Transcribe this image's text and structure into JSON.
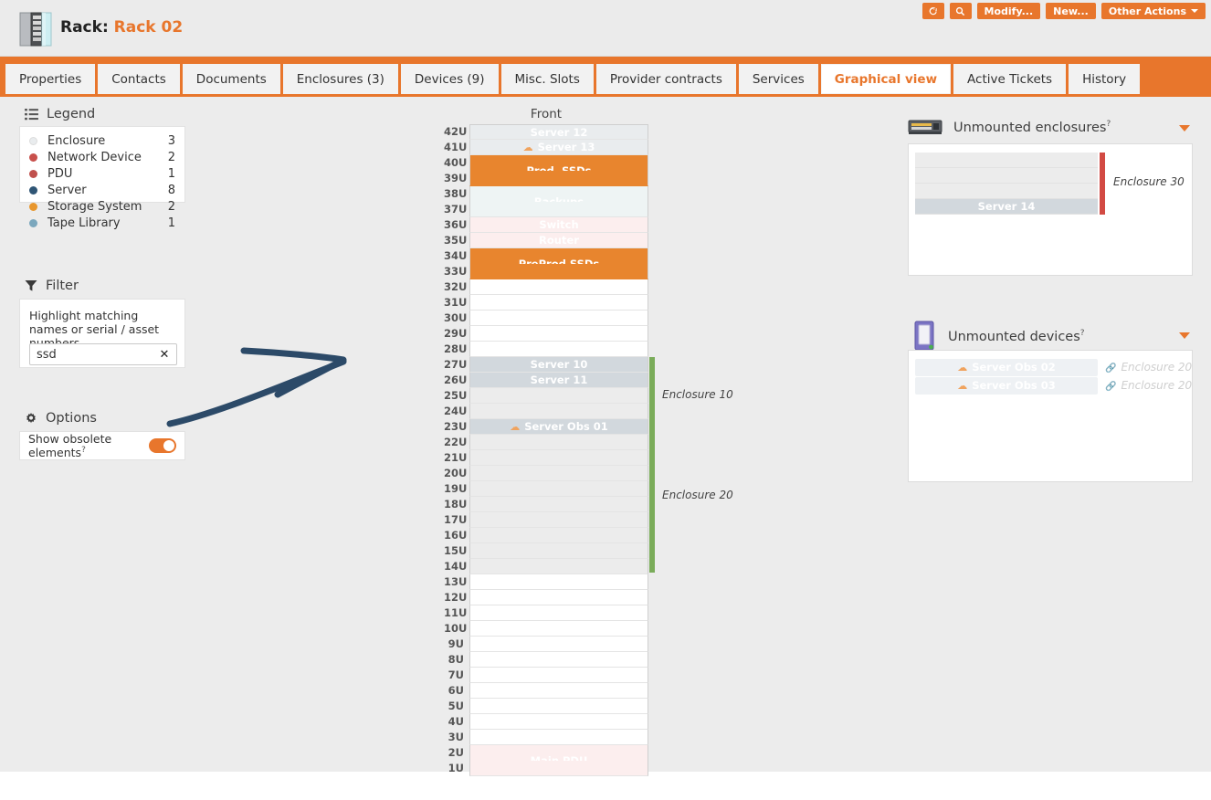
{
  "header": {
    "object_type_label": "Rack:",
    "object_name": "Rack 02",
    "icon": "rack-icon",
    "buttons": [
      {
        "name": "refresh-button",
        "label": "",
        "icon": "refresh-icon"
      },
      {
        "name": "search-button",
        "label": "",
        "icon": "search-icon"
      },
      {
        "name": "modify-button",
        "label": "Modify...",
        "icon": ""
      },
      {
        "name": "new-button",
        "label": "New...",
        "icon": ""
      },
      {
        "name": "other-actions-button",
        "label": "Other Actions",
        "icon": "chevron-down-icon"
      }
    ]
  },
  "tabs": [
    {
      "label": "Properties",
      "active": false
    },
    {
      "label": "Contacts",
      "active": false
    },
    {
      "label": "Documents",
      "active": false
    },
    {
      "label": "Enclosures (3)",
      "active": false
    },
    {
      "label": "Devices (9)",
      "active": false
    },
    {
      "label": "Misc. Slots",
      "active": false
    },
    {
      "label": "Provider contracts",
      "active": false
    },
    {
      "label": "Services",
      "active": false
    },
    {
      "label": "Graphical view",
      "active": true
    },
    {
      "label": "Active Tickets",
      "active": false
    },
    {
      "label": "History",
      "active": false
    }
  ],
  "sidebar": {
    "legend": {
      "title": "Legend",
      "icon": "list-icon",
      "items": [
        {
          "label": "Enclosure",
          "count": "3",
          "color": "#e9ecee"
        },
        {
          "label": "Network Device",
          "count": "2",
          "color": "#c8504c"
        },
        {
          "label": "PDU",
          "count": "1",
          "color": "#c0504d"
        },
        {
          "label": "Server",
          "count": "8",
          "color": "#2f5575"
        },
        {
          "label": "Storage System",
          "count": "2",
          "color": "#e8972e"
        },
        {
          "label": "Tape Library",
          "count": "1",
          "color": "#7ba7bd"
        }
      ]
    },
    "filter": {
      "title": "Filter",
      "icon": "funnel-icon",
      "hint": "Highlight matching names or serial / asset numbers",
      "value": "ssd",
      "placeholder": "",
      "clear_label": "✕"
    },
    "options": {
      "title": "Options",
      "icon": "gear-icon",
      "show_obsolete_label": "Show obsolete elements",
      "help_marker": "?",
      "show_obsolete_on": true,
      "toggle_color": "#e8762c"
    }
  },
  "rack": {
    "face_label": "Front",
    "u_labels": [
      "42U",
      "41U",
      "40U",
      "39U",
      "38U",
      "37U",
      "36U",
      "35U",
      "34U",
      "33U",
      "32U",
      "31U",
      "30U",
      "29U",
      "28U",
      "27U",
      "26U",
      "25U",
      "24U",
      "23U",
      "22U",
      "21U",
      "20U",
      "19U",
      "18U",
      "17U",
      "16U",
      "15U",
      "14U",
      "13U",
      "12U",
      "11U",
      "10U",
      "9U",
      "8U",
      "7U",
      "6U",
      "5U",
      "4U",
      "3U",
      "2U",
      "1U"
    ],
    "elements": [
      {
        "name": "Server 12",
        "start_u": "42U",
        "height_u": 1,
        "color": "#e9ecee",
        "label_color": "#ffffff",
        "obsolete": false,
        "highlighted": false
      },
      {
        "name": "Server 13",
        "start_u": "41U",
        "height_u": 1,
        "color": "#e9ecee",
        "label_color": "#ffffff",
        "obsolete": true,
        "highlighted": false
      },
      {
        "name": "Prod. SSDs",
        "start_u": "40U",
        "height_u": 2,
        "color": "#e8852e",
        "label_color": "#ffffff",
        "obsolete": false,
        "highlighted": true
      },
      {
        "name": "Backups",
        "start_u": "38U",
        "height_u": 2,
        "color": "#eef4f4",
        "label_color": "#ffffff",
        "obsolete": false,
        "highlighted": false
      },
      {
        "name": "Switch",
        "start_u": "36U",
        "height_u": 1,
        "color": "#fceeee",
        "label_color": "#ffffff",
        "obsolete": false,
        "highlighted": false
      },
      {
        "name": "Router",
        "start_u": "35U",
        "height_u": 1,
        "color": "#fceeee",
        "label_color": "#ffffff",
        "obsolete": false,
        "highlighted": false
      },
      {
        "name": "PreProd SSDs",
        "start_u": "34U",
        "height_u": 2,
        "color": "#e8852e",
        "label_color": "#ffffff",
        "obsolete": false,
        "highlighted": true
      },
      {
        "name": "Server 10",
        "start_u": "27U",
        "height_u": 1,
        "color": "#d2d8dd",
        "label_color": "#ffffff",
        "obsolete": false,
        "highlighted": false
      },
      {
        "name": "Server 11",
        "start_u": "26U",
        "height_u": 1,
        "color": "#d2d8dd",
        "label_color": "#ffffff",
        "obsolete": false,
        "highlighted": false
      },
      {
        "name": "Server Obs 01",
        "start_u": "23U",
        "height_u": 1,
        "color": "#d2d8dd",
        "label_color": "#ffffff",
        "obsolete": true,
        "highlighted": false
      },
      {
        "name": "Main PDU",
        "start_u": "2U",
        "height_u": 2,
        "color": "#fceeee",
        "label_color": "#ffffff",
        "obsolete": false,
        "highlighted": false
      }
    ],
    "enclosure_slots": [
      {
        "name": "Enclosure 10",
        "start_u": "27U",
        "height_u": 5,
        "bar_color": "#7aac5a",
        "slot_color": "#ececec"
      },
      {
        "name": "Enclosure 20",
        "start_u": "23U",
        "height_u": 10,
        "bar_color": "#7aac5a",
        "slot_color": "#ececec"
      }
    ]
  },
  "unmounted_enclosures": {
    "title": "Unmounted enclosures",
    "help_marker": "?",
    "icon": "enclosure-icon",
    "collapse_icon": "chevron-down-icon",
    "enclosures": [
      {
        "name": "Enclosure 30",
        "bar_color": "#d24a43",
        "slots": 4,
        "devices": [
          {
            "name": "Server 14",
            "slot_index": 3,
            "color": "#d2d8dd"
          }
        ]
      }
    ]
  },
  "unmounted_devices": {
    "title": "Unmounted devices",
    "help_marker": "?",
    "icon": "device-icon",
    "collapse_icon": "chevron-down-icon",
    "items": [
      {
        "name": "Server Obs 02",
        "obsolete": true,
        "enclosure": "Enclosure 20",
        "link_icon": "link-icon"
      },
      {
        "name": "Server Obs 03",
        "obsolete": true,
        "enclosure": "Enclosure 20",
        "link_icon": "link-icon"
      }
    ]
  },
  "annotation": {
    "type": "hand-drawn-arrow",
    "color": "#2c4a68"
  }
}
